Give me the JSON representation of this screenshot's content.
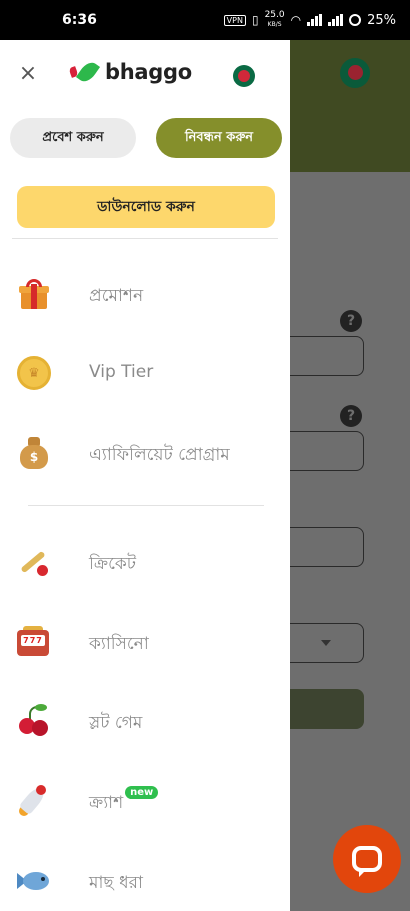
{
  "status_bar": {
    "time": "6:36",
    "vpn": "VPN",
    "net_speed": "25.0",
    "net_unit": "KB/S",
    "battery": "25%"
  },
  "drawer": {
    "brand": "bhaggo",
    "login_label": "প্রবেশ করুন",
    "register_label": "নিবন্ধন করুন",
    "download_label": "ডাউনলোড করুন",
    "menu": [
      {
        "label": "প্রমোশন",
        "icon": "gift-icon"
      },
      {
        "label": "Vip Tier",
        "icon": "crown-coin-icon"
      },
      {
        "label": "এ্যাফিলিয়েট প্রোগ্রাম",
        "icon": "money-bag-icon"
      },
      {
        "label": "ক্রিকেট",
        "icon": "cricket-bat-icon"
      },
      {
        "label": "ক্যাসিনো",
        "icon": "slot-machine-icon"
      },
      {
        "label": "স্লট গেম",
        "icon": "cherry-icon"
      },
      {
        "label": "ক্র্যাশ",
        "icon": "rocket-icon",
        "badge": "new"
      },
      {
        "label": "মাছ ধরা",
        "icon": "fish-icon"
      }
    ],
    "slot_window_text": "777"
  },
  "background": {
    "help_glyph": "?"
  },
  "colors": {
    "register_bg": "#858f2b",
    "download_bg": "#fdd76c",
    "chat_fab": "#e2460c",
    "new_badge": "#2fbf4e"
  }
}
